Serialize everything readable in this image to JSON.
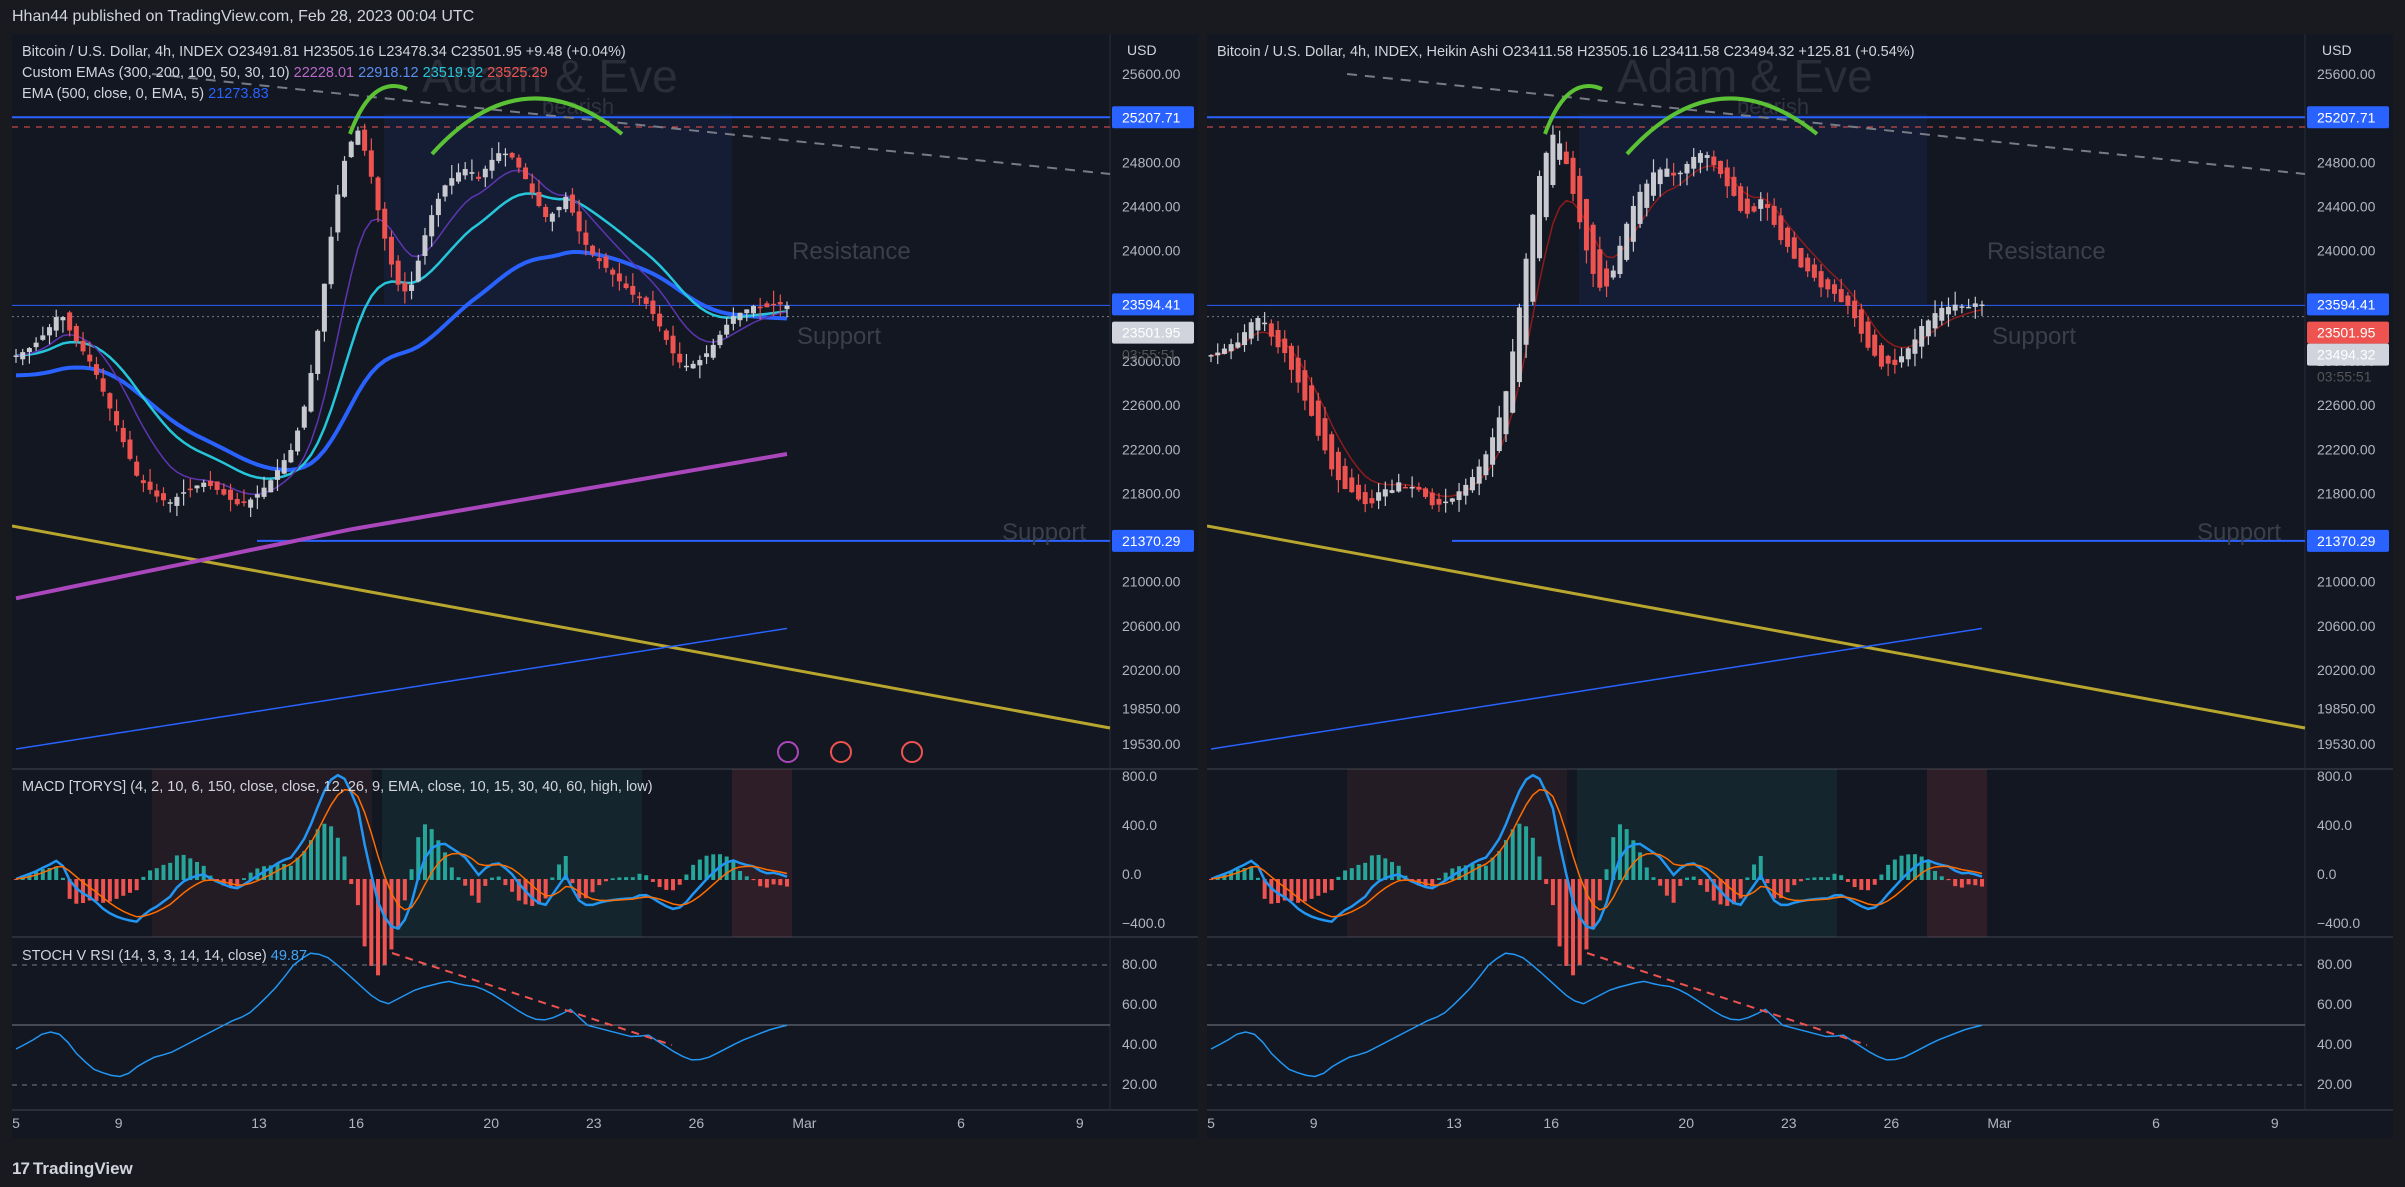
{
  "header": {
    "published": "Hhan44 published on TradingView.com, Feb 28, 2023 00:04 UTC"
  },
  "footer": {
    "brand": "TradingView",
    "brand_mark": "17"
  },
  "panels": [
    {
      "legend1": "Bitcoin / U.S. Dollar, 4h, INDEX  O23491.81  H23505.16  L23478.34  C23501.95  +9.48 (+0.04%)",
      "legend2_label": "Custom EMAs (300, 200, 100, 50, 30, 10)",
      "legend2_vals": [
        "22228.01",
        "22918.12",
        "23519.92",
        "23525.29"
      ],
      "legend3_label": "EMA (500, close, 0, EMA, 5)",
      "legend3_val": "21273.83",
      "watermark": "Adam & Eve",
      "pattern_label": "bearish",
      "price_badge": "23501.95",
      "countdown": "03:55:51",
      "high_badge": "23594.41",
      "res_badge": "25207.71",
      "sup_badge": "21370.29",
      "macd_label": "MACD [TORYS] (4, 2, 10, 6, 150, close, close, 12, 26, 9, EMA, close, 10, 15, 30, 40, 60, high, low)",
      "stoch_label": "STOCH V RSI (14, 3, 3, 14, 14, close)",
      "stoch_val": "49.87"
    },
    {
      "legend1": "Bitcoin / U.S. Dollar, 4h, INDEX, Heikin Ashi  O23411.58  H23505.16  L23411.58  C23494.32  +125.81 (+0.54%)",
      "watermark": "Adam & Eve",
      "pattern_label": "bearish",
      "price_badge": "23501.95",
      "last_badge": "23494.32",
      "countdown": "03:55:51",
      "high_badge": "23594.41",
      "res_badge": "25207.71",
      "sup_badge": "21370.29"
    }
  ],
  "currency": "USD",
  "annotations": {
    "resistance": "Resistance",
    "support": "Support"
  },
  "colors": {
    "up": "#26a69a",
    "down": "#ef5350",
    "ha_up": "#c8cad0",
    "ha_down": "#ef5350",
    "ema_cyan": "#26c6da",
    "ema_blue": "#2962ff",
    "ema_purple": "#ab47bc",
    "trend_yellow": "#b8a62e",
    "arc_green": "#5bc236",
    "macd_line": "#2196f3",
    "signal": "#ff6d00"
  },
  "chart_data": [
    {
      "type": "candlestick",
      "title": "Bitcoin / U.S. Dollar, 4h, INDEX",
      "ylim": [
        19350,
        25900
      ],
      "price_ticks": [
        "25600.00",
        "24800.00",
        "24400.00",
        "24000.00",
        "23000.00",
        "22600.00",
        "22200.00",
        "21800.00",
        "21000.00",
        "20600.00",
        "20200.00",
        "19850.00",
        "19530.00"
      ],
      "time_ticks": [
        "5",
        "9",
        "13",
        "16",
        "20",
        "23",
        "26",
        "Mar",
        "6",
        "9"
      ],
      "close_path": [
        23050,
        23100,
        23180,
        23300,
        23450,
        23250,
        23100,
        22950,
        22700,
        22450,
        22200,
        21950,
        21850,
        21750,
        21720,
        21800,
        21850,
        21900,
        21850,
        21780,
        21700,
        21720,
        21800,
        21900,
        22050,
        22200,
        22500,
        23000,
        23700,
        24400,
        24900,
        25100,
        24800,
        24300,
        23900,
        23600,
        23700,
        24100,
        24400,
        24600,
        24700,
        24750,
        24650,
        24800,
        24900,
        24850,
        24700,
        24500,
        24300,
        24350,
        24500,
        24200,
        24000,
        23900,
        23800,
        23700,
        23600,
        23550,
        23400,
        23200,
        23000,
        22950,
        23000,
        23100,
        23250,
        23400,
        23450,
        23500,
        23480,
        23520,
        23501.95
      ],
      "stoch_rsi_k": [
        38,
        42,
        47,
        45,
        35,
        28,
        25,
        24,
        30,
        34,
        36,
        40,
        44,
        48,
        52,
        55,
        62,
        70,
        80,
        86,
        85,
        79,
        72,
        65,
        60,
        64,
        68,
        70,
        72,
        70,
        69,
        65,
        60,
        55,
        52,
        54,
        58,
        50,
        48,
        46,
        44,
        45,
        40,
        35,
        32,
        34,
        38,
        42,
        45,
        48,
        49.87
      ]
    },
    {
      "type": "heikin_ashi",
      "title": "Bitcoin / U.S. Dollar, 4h, INDEX, Heikin Ashi",
      "ylim": [
        19350,
        25900
      ],
      "price_ticks": [
        "25600.00",
        "24800.00",
        "24400.00",
        "24000.00",
        "23000.00",
        "22600.00",
        "22200.00",
        "21800.00",
        "21000.00",
        "20600.00",
        "20200.00",
        "19850.00",
        "19530.00"
      ],
      "time_ticks": [
        "5",
        "9",
        "13",
        "16",
        "20",
        "23",
        "26",
        "Mar",
        "6",
        "9"
      ]
    }
  ],
  "macd": {
    "y_ticks": [
      "800.0",
      "400.0",
      "0.0",
      "−400.0"
    ]
  },
  "stoch": {
    "y_ticks": [
      "80.00",
      "60.00",
      "40.00",
      "20.00"
    ]
  },
  "markers": [
    "lightning-icon",
    "us-flag-icon",
    "us-flag-icon"
  ]
}
